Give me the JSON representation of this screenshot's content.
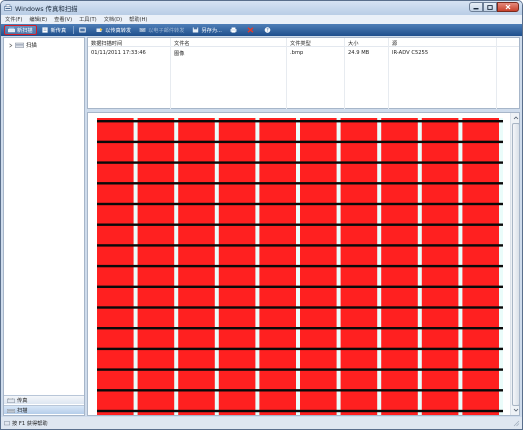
{
  "window": {
    "title": "Windows 传真和扫描"
  },
  "menu": [
    "文件(F)",
    "编辑(E)",
    "查看(V)",
    "工具(T)",
    "文档(D)",
    "帮助(H)"
  ],
  "toolbar": {
    "new_scan": "新扫描",
    "new_fax": "新传真",
    "forward_fax": "以传真转发",
    "forward_email": "以电子邮件转发",
    "save_as": "另存为..."
  },
  "nav": {
    "tree_item": "扫描",
    "bottom_fax": "传真",
    "bottom_scan": "扫描"
  },
  "list": {
    "headers": [
      "数据扫描时间",
      "文件名",
      "文件类型",
      "大小",
      "源"
    ],
    "rows": [
      [
        "01/11/2011 17:33:46",
        "图像",
        ".bmp",
        "24.9 MB",
        "IR-ADV C5255"
      ]
    ]
  },
  "status": {
    "text": "按 F1 获得帮助"
  },
  "colors": {
    "image_red": "#ff2020",
    "image_line": "#0a0a0a",
    "image_gap": "#eafcfa",
    "toolbar_bg": "#2f5f9c",
    "highlight": "#d3202a"
  },
  "preview": {
    "columns": 10,
    "lines": 22
  }
}
